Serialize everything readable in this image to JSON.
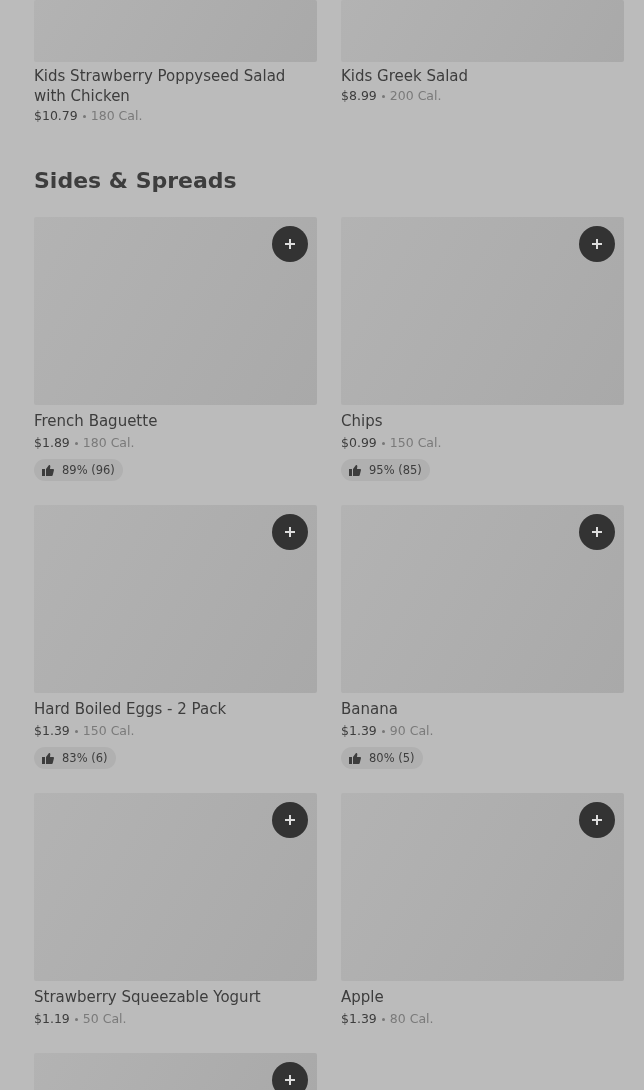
{
  "top_items": [
    {
      "name": "Kids Strawberry Poppyseed Salad with Chicken",
      "price": "$10.79",
      "calories": "180 Cal."
    },
    {
      "name": "Kids Greek Salad",
      "price": "$8.99",
      "calories": "200 Cal."
    }
  ],
  "section": {
    "title": "Sides & Spreads",
    "items": [
      {
        "name": "French Baguette",
        "price": "$1.89",
        "calories": "180 Cal.",
        "rating": "89% (96)"
      },
      {
        "name": "Chips",
        "price": "$0.99",
        "calories": "150 Cal.",
        "rating": "95% (85)"
      },
      {
        "name": "Hard Boiled Eggs - 2 Pack",
        "price": "$1.39",
        "calories": "150 Cal.",
        "rating": "83% (6)"
      },
      {
        "name": "Banana",
        "price": "$1.39",
        "calories": "90 Cal.",
        "rating": "80% (5)"
      },
      {
        "name": "Strawberry Squeezable Yogurt",
        "price": "$1.19",
        "calories": "50 Cal."
      },
      {
        "name": "Apple",
        "price": "$1.39",
        "calories": "80 Cal."
      },
      {
        "kind": "cut"
      }
    ]
  }
}
